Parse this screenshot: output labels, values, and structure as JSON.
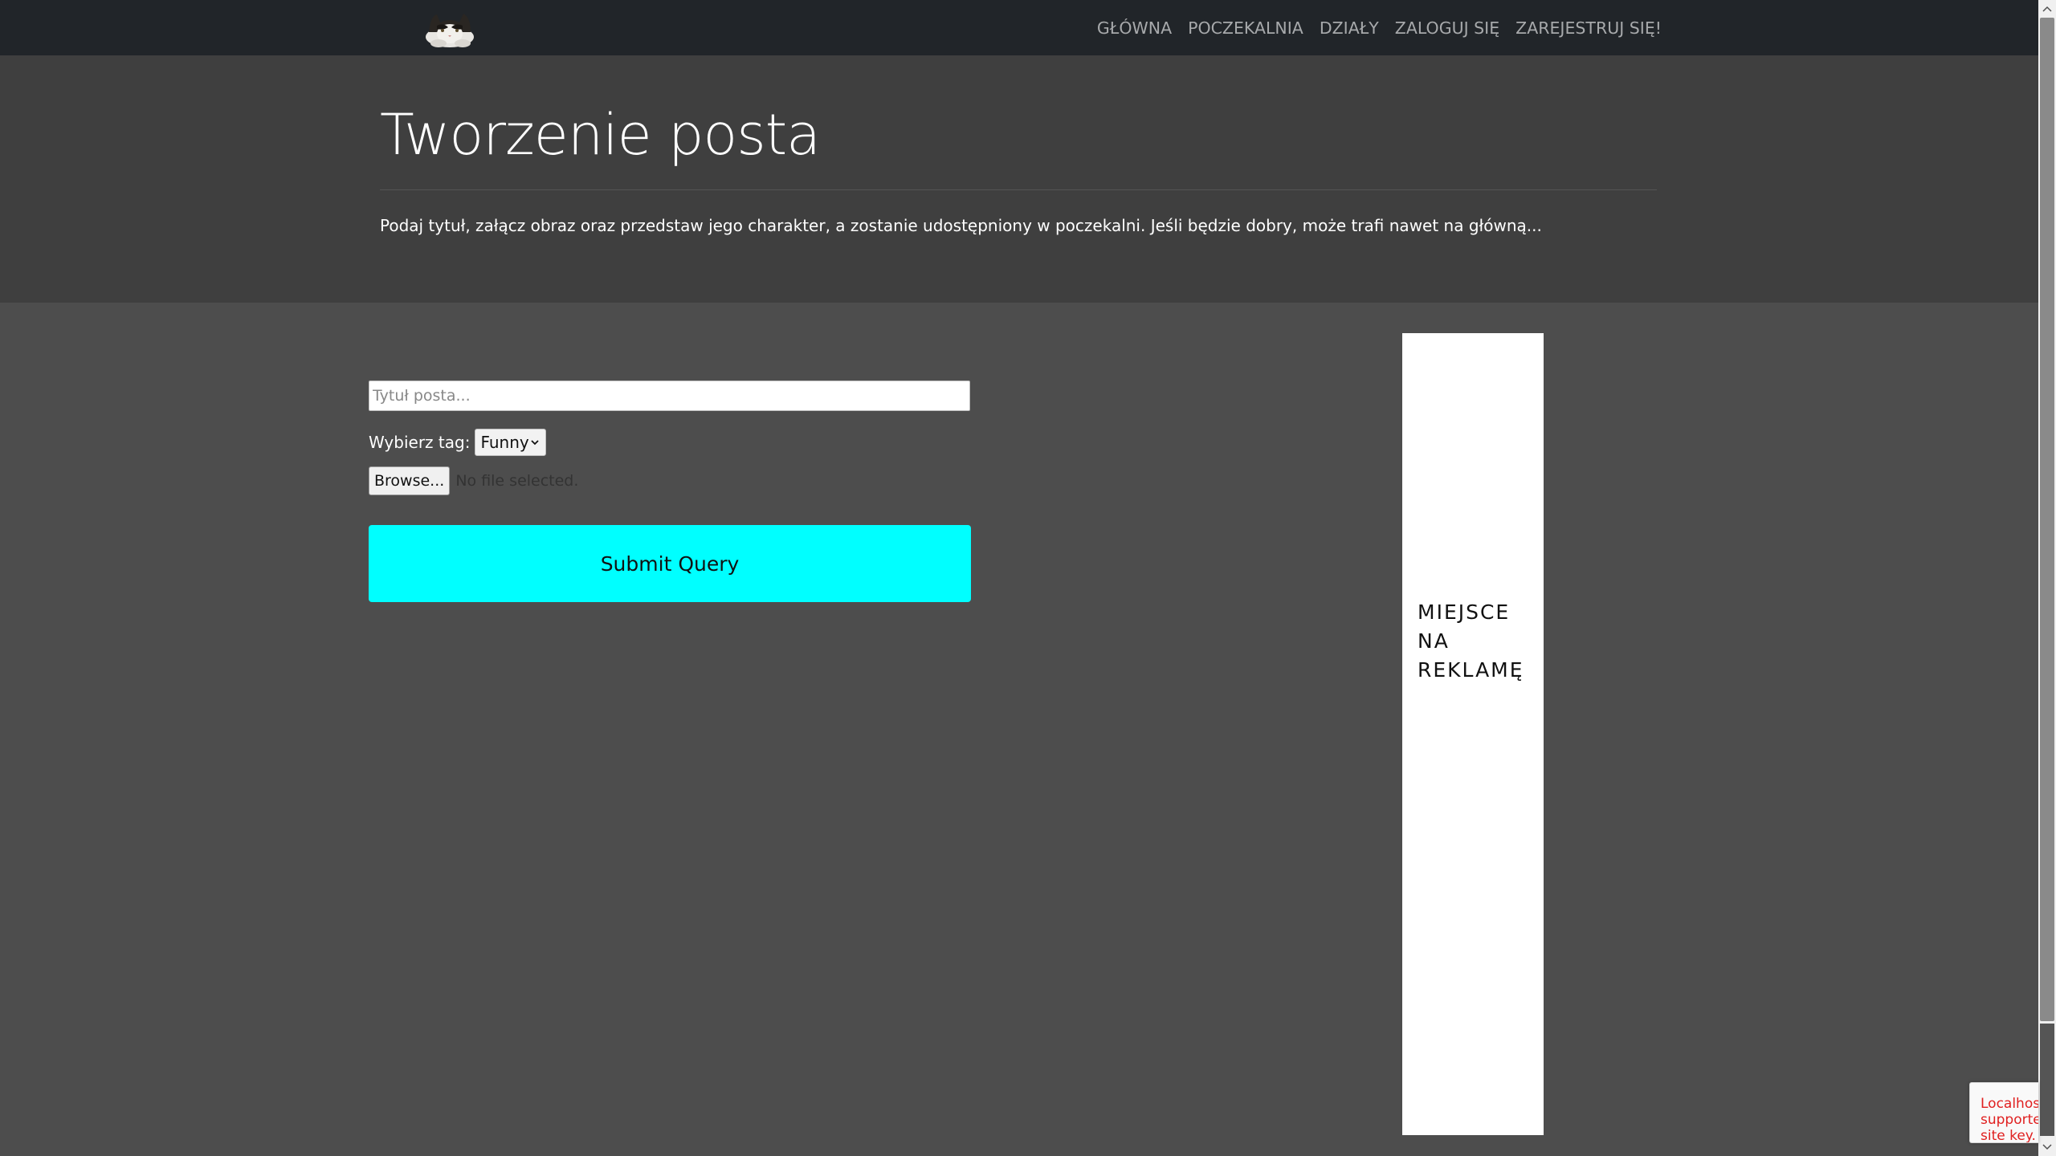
{
  "nav": {
    "items": [
      "GŁÓWNA",
      "POCZEKALNIA",
      "DZIAŁY",
      "ZALOGUJ SIĘ",
      "ZAREJESTRUJ SIĘ!"
    ]
  },
  "header": {
    "title": "Tworzenie posta",
    "lead": "Podaj tytuł, załącz obraz oraz przedstaw jego charakter, a zostanie udostępniony w poczekalni. Jeśli będzie dobry, może trafi nawet na główną..."
  },
  "form": {
    "title_placeholder": "Tytuł posta...",
    "title_value": "",
    "tag_label": "Wybierz tag:",
    "tag_selected": "Funny",
    "browse_label": "Browse...",
    "file_status": "No file selected.",
    "submit_label": "Submit Query"
  },
  "ad": {
    "lines": [
      "MIEJSCE",
      "NA",
      "REKLAMĘ"
    ]
  },
  "recaptcha": {
    "lines": [
      "Localhost",
      "supported",
      "site key."
    ]
  },
  "colors": {
    "navbar": "#212529",
    "header": "#3f3f3f",
    "page_bg": "#4d4d4d",
    "submit": "#00ffff",
    "recaptcha_error": "#e02020"
  },
  "icons": {
    "logo": "cat-logo-icon",
    "select": "chevron-down-icon",
    "scroll_up": "triangle-up-icon",
    "scroll_down": "triangle-down-icon"
  }
}
